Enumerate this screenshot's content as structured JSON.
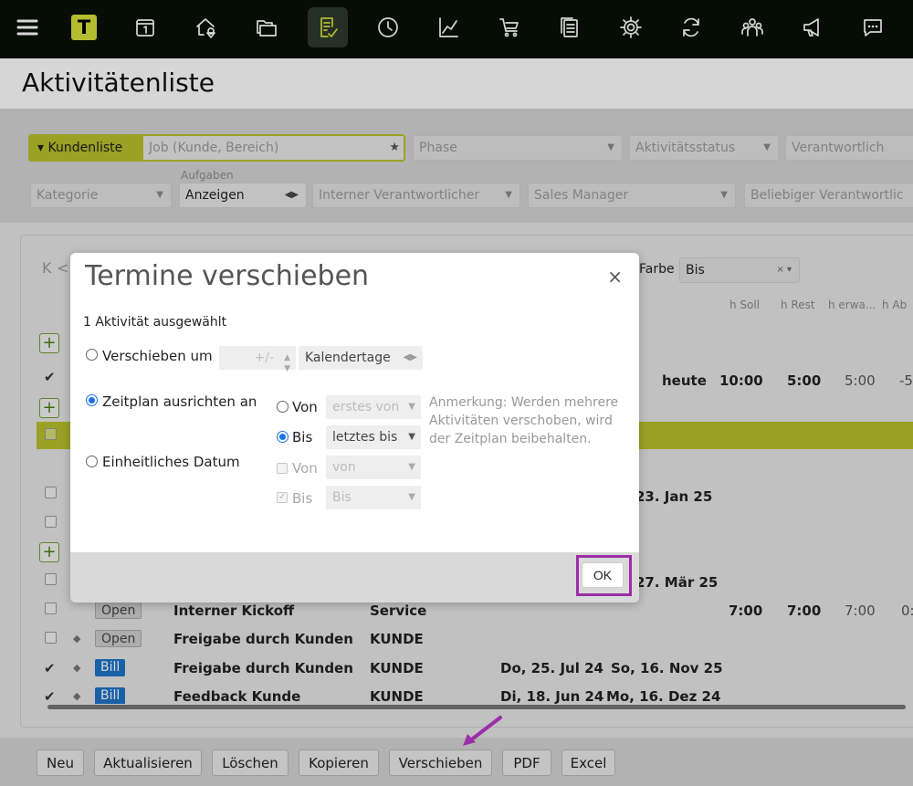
{
  "nav": {
    "icons": [
      "menu-icon",
      "app-logo",
      "calendar-icon",
      "home-location-icon",
      "folders-icon",
      "task-list-icon",
      "clock-icon",
      "chart-icon",
      "cart-icon",
      "documents-icon",
      "settings-icon",
      "sync-icon",
      "team-icon",
      "megaphone-icon",
      "chat-icon"
    ],
    "logo_letter": "T"
  },
  "page": {
    "title": "Aktivitätenliste"
  },
  "filters": {
    "kundenliste": "Kundenliste",
    "job_placeholder": "Job (Kunde, Bereich)",
    "phase": "Phase",
    "aktivitaetsstatus": "Aktivitätsstatus",
    "verantwortlich": "Verantwortlich",
    "kategorie": "Kategorie",
    "aufgaben_label": "Aufgaben",
    "aufgaben_value": "Anzeigen",
    "interner_verantwortlicher": "Interner Verantwortlicher",
    "sales_manager": "Sales Manager",
    "beliebiger_verantwortlicher": "Beliebiger Verantwortlic"
  },
  "toolbar": {
    "first_page": "K",
    "prev": "<",
    "farbe_label": "Farbe",
    "bis_value": "Bis",
    "clear": "×"
  },
  "columns": [
    "h Soll",
    "h Rest",
    "h erwa...",
    "h Ab"
  ],
  "rows": {
    "row1": {
      "date": "heute",
      "soll": "10:00",
      "rest": "5:00",
      "erw": "5:00",
      "ab": "-5:"
    },
    "row2": {
      "end": "23. Jan 25"
    },
    "row3": {
      "end": "27. Mär 25"
    },
    "row4": {
      "status": "Open",
      "name": "Interner Kickoff",
      "type": "Service",
      "soll": "7:00",
      "rest": "7:00",
      "erw": "7:00",
      "ab": "0:"
    },
    "row5": {
      "status": "Open",
      "name": "Freigabe durch Kunden",
      "type": "KUNDE"
    },
    "row6": {
      "status": "Bill",
      "name": "Freigabe durch Kunden",
      "type": "KUNDE",
      "start": "Do, 25. Jul 24",
      "end": "So, 16. Nov 25"
    },
    "row7": {
      "status": "Bill",
      "name": "Feedback Kunde",
      "type": "KUNDE",
      "start": "Di, 18. Jun 24",
      "end": "Mo, 16. Dez 24"
    }
  },
  "buttons": [
    "Neu",
    "Aktualisieren",
    "Löschen",
    "Kopieren",
    "Verschieben",
    "PDF",
    "Excel"
  ],
  "dialog": {
    "title": "Termine verschieben",
    "close": "×",
    "selected_count": "1 Aktivität ausgewählt",
    "option_shift": "Verschieben um",
    "shift_placeholder": "+/-",
    "shift_unit": "Kalendertage",
    "option_align": "Zeitplan ausrichten an",
    "von_label": "Von",
    "bis_label": "Bis",
    "von_value": "erstes von",
    "bis_value": "letztes bis",
    "note": [
      "Anmerkung: Werden mehrere",
      "Aktivitäten verschoben, wird",
      "der Zeitplan beibehalten."
    ],
    "option_uniform": "Einheitliches Datum",
    "uniform_von": "von",
    "uniform_bis": "Bis",
    "ok": "OK"
  },
  "colors": {
    "accent": "#B9C02C",
    "nav_bg": "#071007",
    "highlight": "#9C2EA8",
    "bill": "#1E74C8"
  }
}
